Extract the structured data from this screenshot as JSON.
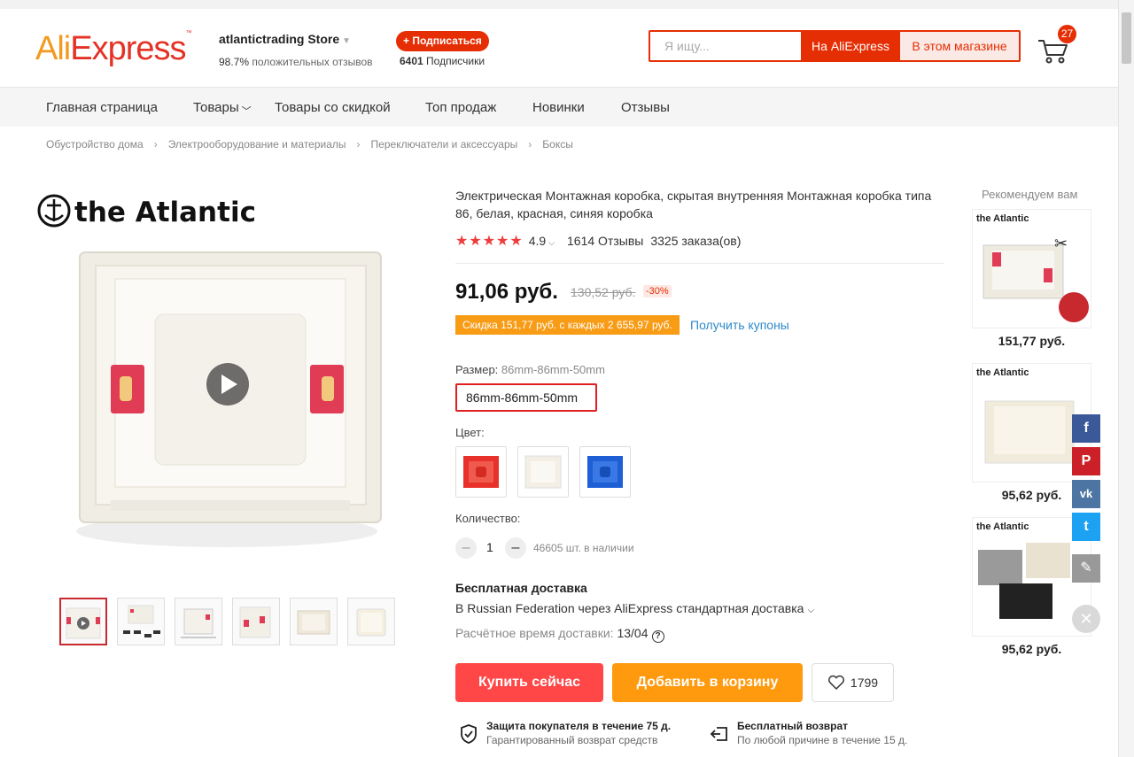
{
  "header": {
    "logo_ali": "Ali",
    "logo_express": "Express",
    "store_name": "atlantictrading Store",
    "store_rating_value": "98.7%",
    "store_rating_text": "положительных отзывов",
    "subscribe_label": "+ Подписаться",
    "subscribers_count": "6401",
    "subscribers_label": "Подписчики",
    "search_placeholder": "Я ищу...",
    "search_aliexpress_label": "На AliExpress",
    "search_store_label": "В этом магазине",
    "cart_count": "27"
  },
  "nav": {
    "items": [
      "Главная страница",
      "Товары",
      "Товары со скидкой",
      "Топ продаж",
      "Новинки",
      "Отзывы"
    ]
  },
  "breadcrumb": [
    "Обустройство дома",
    "Электрооборудование и материалы",
    "Переключатели и аксессуары",
    "Боксы"
  ],
  "gallery": {
    "brand_text": "the Atlantic"
  },
  "product": {
    "title": "Электрическая Монтажная коробка, скрытая внутренняя Монтажная коробка типа 86, белая, красная, синяя коробка",
    "rating": "4.9",
    "reviews": "1614 Отзывы",
    "orders": "3325 заказа(ов)",
    "price": "91,06 руб.",
    "old_price": "130,52 руб.",
    "discount": "-30%",
    "coupon_tag": "Скидка 151,77 руб. с каждых 2 655,97 руб.",
    "coupon_link": "Получить купоны",
    "size_label": "Размер:",
    "size_value": "86mm-86mm-50mm",
    "size_option": "86mm-86mm-50mm",
    "color_label": "Цвет:",
    "colors": [
      "#e8312a",
      "#f3efe6",
      "#1e5fd6"
    ],
    "quantity_label": "Количество:",
    "quantity": "1",
    "stock": "46605 шт. в наличии",
    "shipping_title": "Бесплатная доставка",
    "shipping_line": "В Russian Federation через AliExpress стандартная доставка",
    "shipping_time_label": "Расчётное время доставки:",
    "shipping_time_value": "13/04",
    "buy_now": "Купить сейчас",
    "add_to_cart": "Добавить в корзину",
    "wishlist_count": "1799",
    "guarantee1_title": "Защита покупателя в течение 75 д.",
    "guarantee1_sub": "Гарантированный возврат средств",
    "guarantee2_title": "Бесплатный возврат",
    "guarantee2_sub": "По любой причине в течение 15 д."
  },
  "recommend": {
    "title": "Рекомендуем вам",
    "brand": "the Atlantic",
    "prices": [
      "151,77 руб.",
      "95,62 руб.",
      "95,62 руб."
    ]
  },
  "share": {
    "facebook": "f",
    "pinterest": "P",
    "vk": "vk",
    "twitter": "t",
    "edit": "✎",
    "close": "✕"
  },
  "colors": {
    "brand_red": "#e62e04",
    "brand_orange": "#f29a1f",
    "buy_red": "#ff4747",
    "cart_orange": "#ff9a0e",
    "facebook": "#3b5998",
    "pinterest": "#cb2027",
    "vk": "#4c75a3",
    "twitter": "#1da1f2"
  }
}
